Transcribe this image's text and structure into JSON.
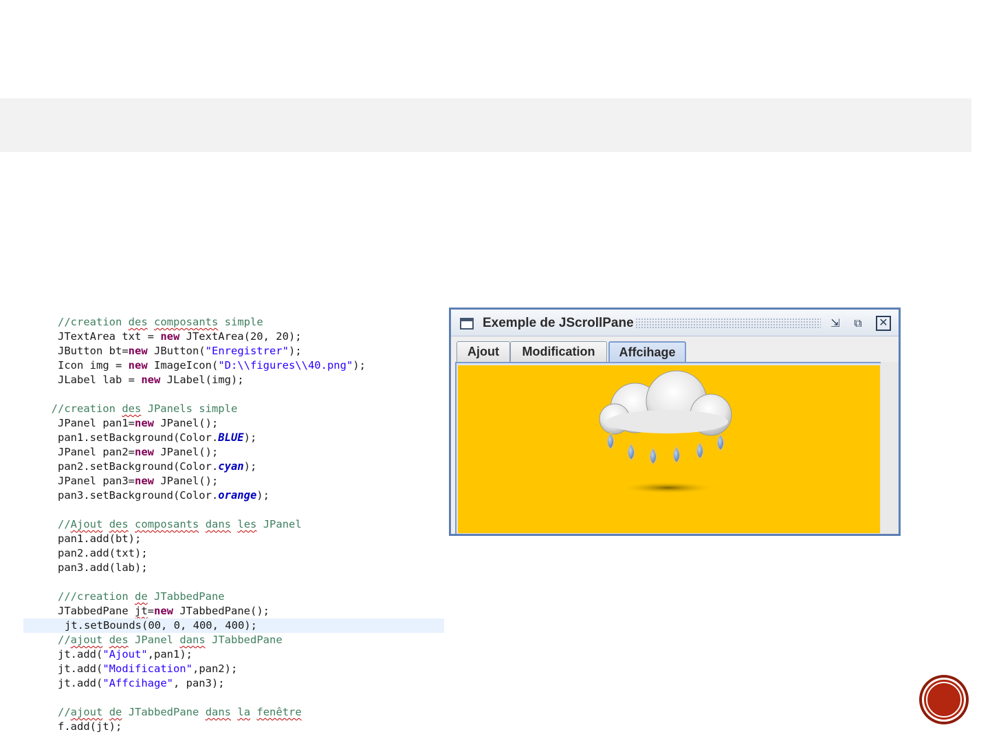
{
  "code": {
    "lines": [
      {
        "indent": "         ",
        "segments": [
          {
            "t": "//creation ",
            "c": "cm"
          },
          {
            "t": "des",
            "c": "cm sq"
          },
          {
            "t": " ",
            "c": "cm"
          },
          {
            "t": "composants",
            "c": "cm sq"
          },
          {
            "t": " simple",
            "c": "cm"
          }
        ]
      },
      {
        "indent": "         ",
        "segments": [
          {
            "t": "JTextArea txt = ",
            "c": ""
          },
          {
            "t": "new",
            "c": "kw"
          },
          {
            "t": " JTextArea(20, 20);",
            "c": ""
          }
        ]
      },
      {
        "indent": "         ",
        "segments": [
          {
            "t": "JButton bt=",
            "c": ""
          },
          {
            "t": "new",
            "c": "kw"
          },
          {
            "t": " JButton(",
            "c": ""
          },
          {
            "t": "\"Enregistrer\"",
            "c": "st"
          },
          {
            "t": ");",
            "c": ""
          }
        ]
      },
      {
        "indent": "         ",
        "segments": [
          {
            "t": "Icon img = ",
            "c": ""
          },
          {
            "t": "new",
            "c": "kw"
          },
          {
            "t": " ImageIcon(",
            "c": ""
          },
          {
            "t": "\"D:\\\\figures\\\\40.png\"",
            "c": "st"
          },
          {
            "t": ");",
            "c": ""
          }
        ]
      },
      {
        "indent": "         ",
        "segments": [
          {
            "t": "JLabel lab = ",
            "c": ""
          },
          {
            "t": "new",
            "c": "kw"
          },
          {
            "t": " JLabel(img);",
            "c": ""
          }
        ]
      },
      {
        "indent": "",
        "segments": []
      },
      {
        "indent": "        ",
        "segments": [
          {
            "t": "//creation ",
            "c": "cm"
          },
          {
            "t": "des",
            "c": "cm sq"
          },
          {
            "t": " JPanels simple",
            "c": "cm"
          }
        ]
      },
      {
        "indent": "         ",
        "segments": [
          {
            "t": "JPanel pan1=",
            "c": ""
          },
          {
            "t": "new",
            "c": "kw"
          },
          {
            "t": " JPanel();",
            "c": ""
          }
        ]
      },
      {
        "indent": "         ",
        "segments": [
          {
            "t": "pan1.setBackground(Color.",
            "c": ""
          },
          {
            "t": "BLUE",
            "c": "cn"
          },
          {
            "t": ");",
            "c": ""
          }
        ]
      },
      {
        "indent": "         ",
        "segments": [
          {
            "t": "JPanel pan2=",
            "c": ""
          },
          {
            "t": "new",
            "c": "kw"
          },
          {
            "t": " JPanel();",
            "c": ""
          }
        ]
      },
      {
        "indent": "         ",
        "segments": [
          {
            "t": "pan2.setBackground(Color.",
            "c": ""
          },
          {
            "t": "cyan",
            "c": "cn"
          },
          {
            "t": ");",
            "c": ""
          }
        ]
      },
      {
        "indent": "         ",
        "segments": [
          {
            "t": "JPanel pan3=",
            "c": ""
          },
          {
            "t": "new",
            "c": "kw"
          },
          {
            "t": " JPanel();",
            "c": ""
          }
        ]
      },
      {
        "indent": "         ",
        "segments": [
          {
            "t": "pan3.setBackground(Color.",
            "c": ""
          },
          {
            "t": "orange",
            "c": "cn"
          },
          {
            "t": ");",
            "c": ""
          }
        ]
      },
      {
        "indent": "",
        "segments": []
      },
      {
        "indent": "         ",
        "segments": [
          {
            "t": "//",
            "c": "cm"
          },
          {
            "t": "Ajout",
            "c": "cm sq"
          },
          {
            "t": " ",
            "c": "cm"
          },
          {
            "t": "des",
            "c": "cm sq"
          },
          {
            "t": " ",
            "c": "cm"
          },
          {
            "t": "composants",
            "c": "cm sq"
          },
          {
            "t": " ",
            "c": "cm"
          },
          {
            "t": "dans",
            "c": "cm sq"
          },
          {
            "t": " ",
            "c": "cm"
          },
          {
            "t": "les",
            "c": "cm sq"
          },
          {
            "t": " JPanel",
            "c": "cm"
          }
        ]
      },
      {
        "indent": "         ",
        "segments": [
          {
            "t": "pan1.add(bt);",
            "c": ""
          }
        ]
      },
      {
        "indent": "         ",
        "segments": [
          {
            "t": "pan2.add(txt);",
            "c": ""
          }
        ]
      },
      {
        "indent": "         ",
        "segments": [
          {
            "t": "pan3.add(lab);",
            "c": ""
          }
        ]
      },
      {
        "indent": "",
        "segments": []
      },
      {
        "indent": "         ",
        "segments": [
          {
            "t": "///creation ",
            "c": "cm"
          },
          {
            "t": "de",
            "c": "cm sq"
          },
          {
            "t": " JTabbedPane",
            "c": "cm"
          }
        ]
      },
      {
        "indent": "         ",
        "segments": [
          {
            "t": "JTabbedPane ",
            "c": ""
          },
          {
            "t": "jt",
            "c": "sq"
          },
          {
            "t": "=",
            "c": ""
          },
          {
            "t": "new",
            "c": "kw"
          },
          {
            "t": " JTabbedPane();",
            "c": ""
          }
        ]
      },
      {
        "indent": "",
        "highlight": true,
        "segments": [
          {
            "t": "jt.setBounds(00, 0, 400, 400);",
            "c": ""
          }
        ]
      },
      {
        "indent": "         ",
        "segments": [
          {
            "t": "//",
            "c": "cm"
          },
          {
            "t": "ajout",
            "c": "cm sq"
          },
          {
            "t": " ",
            "c": "cm"
          },
          {
            "t": "des",
            "c": "cm sq"
          },
          {
            "t": " JPanel ",
            "c": "cm"
          },
          {
            "t": "dans",
            "c": "cm sq"
          },
          {
            "t": " JTabbedPane",
            "c": "cm"
          }
        ]
      },
      {
        "indent": "         ",
        "segments": [
          {
            "t": "jt.add(",
            "c": ""
          },
          {
            "t": "\"Ajout\"",
            "c": "st"
          },
          {
            "t": ",pan1);",
            "c": ""
          }
        ]
      },
      {
        "indent": "         ",
        "segments": [
          {
            "t": "jt.add(",
            "c": ""
          },
          {
            "t": "\"Modification\"",
            "c": "st"
          },
          {
            "t": ",pan2);",
            "c": ""
          }
        ]
      },
      {
        "indent": "         ",
        "segments": [
          {
            "t": "jt.add(",
            "c": ""
          },
          {
            "t": "\"Affcihage\"",
            "c": "st"
          },
          {
            "t": ", pan3);",
            "c": ""
          }
        ]
      },
      {
        "indent": "",
        "segments": []
      },
      {
        "indent": "         ",
        "segments": [
          {
            "t": "//",
            "c": "cm"
          },
          {
            "t": "ajout",
            "c": "cm sq"
          },
          {
            "t": " ",
            "c": "cm"
          },
          {
            "t": "de",
            "c": "cm sq"
          },
          {
            "t": " JTabbedPane ",
            "c": "cm"
          },
          {
            "t": "dans",
            "c": "cm sq"
          },
          {
            "t": " ",
            "c": "cm"
          },
          {
            "t": "la",
            "c": "cm sq"
          },
          {
            "t": " ",
            "c": "cm"
          },
          {
            "t": "fenêtre",
            "c": "cm sq"
          }
        ]
      },
      {
        "indent": "         ",
        "segments": [
          {
            "t": "f.add(jt);",
            "c": ""
          }
        ]
      }
    ]
  },
  "window": {
    "title": "Exemple de JScrollPane",
    "tabs": [
      "Ajout",
      "Modification",
      "Affcihage"
    ],
    "active_tab": "Affcihage",
    "panel_color": "#ffc600",
    "panel_icon": "rain-cloud-icon",
    "controls": {
      "iconify": "⇲",
      "maximize": "⧉",
      "close": "✕"
    }
  },
  "colors": {
    "title_band": "#f2f2f2",
    "next_button": "#b3260f"
  }
}
